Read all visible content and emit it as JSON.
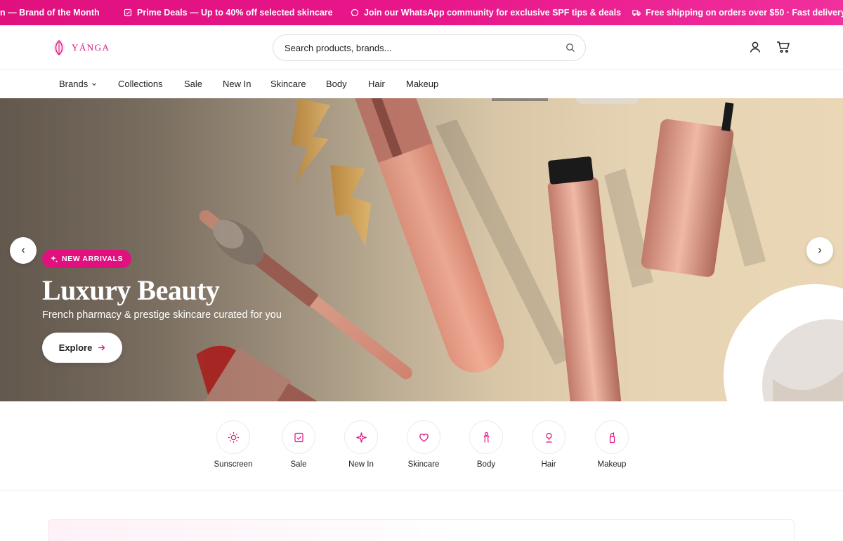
{
  "announcement": {
    "messages": [
      {
        "text": "n — Brand of the Month",
        "icon": "none"
      },
      {
        "text": "Prime Deals — Up to 40% off selected skincare",
        "icon": "tag-icon"
      },
      {
        "text": "Join our WhatsApp community for exclusive SPF tips & deals",
        "icon": "chat-icon"
      },
      {
        "text": "Free shipping on orders over $50 · Fast delivery",
        "icon": "truck-icon"
      }
    ]
  },
  "header": {
    "logo_text": "YÁNGA",
    "search_placeholder": "Search products, brands..."
  },
  "nav": {
    "items": [
      "Brands",
      "Collections",
      "Sale",
      "New In",
      "Skincare",
      "Body",
      "Hair",
      "Makeup"
    ]
  },
  "hero": {
    "badge": "NEW ARRIVALS",
    "title": "Luxury Beauty",
    "subtitle": "French pharmacy & prestige skincare curated for you",
    "cta": "Explore",
    "prev_symbol": "‹",
    "next_symbol": "›"
  },
  "categories": [
    {
      "label": "Sunscreen",
      "icon": "sun-icon"
    },
    {
      "label": "Sale",
      "icon": "tag-icon"
    },
    {
      "label": "New In",
      "icon": "sparkle-icon"
    },
    {
      "label": "Skincare",
      "icon": "heart-icon"
    },
    {
      "label": "Body",
      "icon": "body-icon"
    },
    {
      "label": "Hair",
      "icon": "hair-icon"
    },
    {
      "label": "Makeup",
      "icon": "lipstick-icon"
    }
  ],
  "colors": {
    "accent": "#e0117f",
    "text": "#222222"
  }
}
